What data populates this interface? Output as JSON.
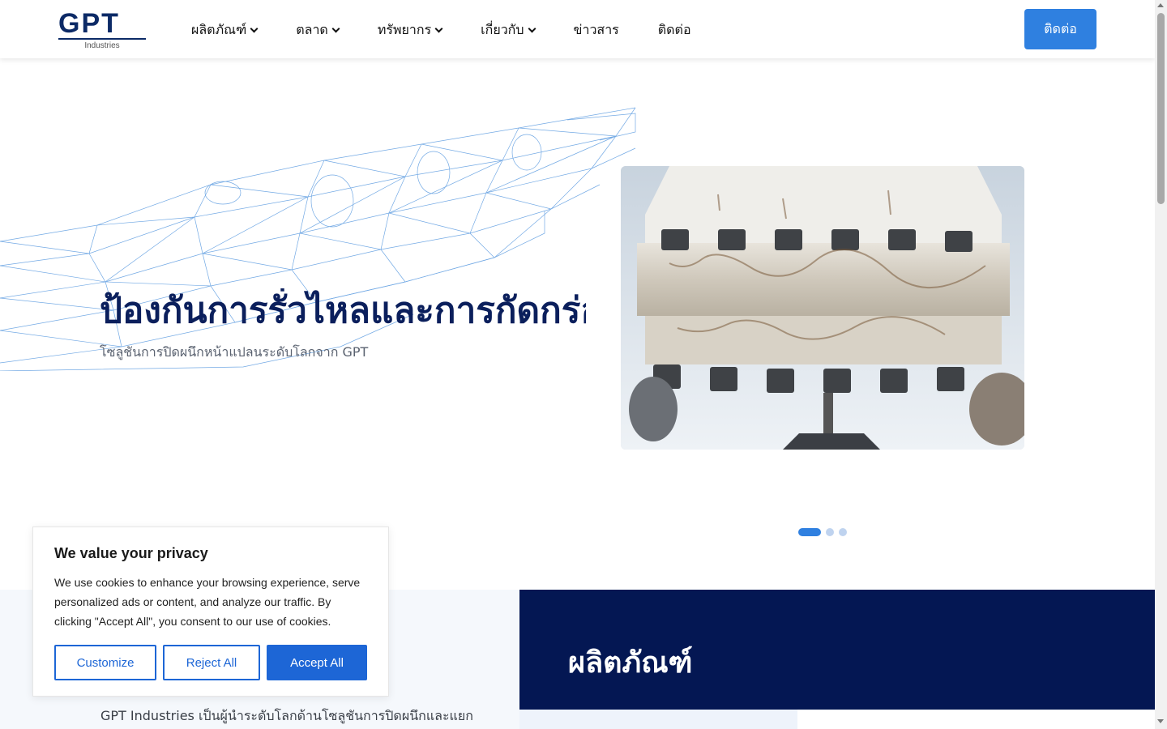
{
  "header": {
    "logo_text": "GPT",
    "logo_sub": "Industries",
    "nav": [
      {
        "label": "ผลิตภัณฑ์",
        "has_dropdown": true
      },
      {
        "label": "ตลาด",
        "has_dropdown": true
      },
      {
        "label": "ทรัพยากร",
        "has_dropdown": true
      },
      {
        "label": "เกี่ยวกับ",
        "has_dropdown": true
      },
      {
        "label": "ข่าวสาร",
        "has_dropdown": false
      },
      {
        "label": "ติดต่อ",
        "has_dropdown": false
      }
    ],
    "cta_label": "ติดต่อ"
  },
  "hero": {
    "title": "ป้องกันการรั่วไหลและการกัดกร่อนของหน้าแปลน",
    "subtitle": "โซลูชันการปิดผนึกหน้าแปลนระดับโลกจาก GPT",
    "image_icon": "flange-bolts-photo",
    "slides_total": 3,
    "slide_active": 1
  },
  "lower": {
    "intro_text": "GPT Industries เป็นผู้นำระดับโลกด้านโซลูชันการปิดผนึกและแยกฉนวนหน้าแปลน",
    "right_title": "ผลิตภัณฑ์"
  },
  "cookie": {
    "title": "We value your privacy",
    "text": "We use cookies to enhance your browsing experience, serve personalized ads or content, and analyze our traffic. By clicking \"Accept All\", you consent to our use of cookies.",
    "customize": "Customize",
    "reject": "Reject All",
    "accept": "Accept All"
  },
  "colors": {
    "brand_navy": "#041753",
    "accent_blue": "#2f80e0",
    "cookie_blue": "#1d66d6"
  }
}
